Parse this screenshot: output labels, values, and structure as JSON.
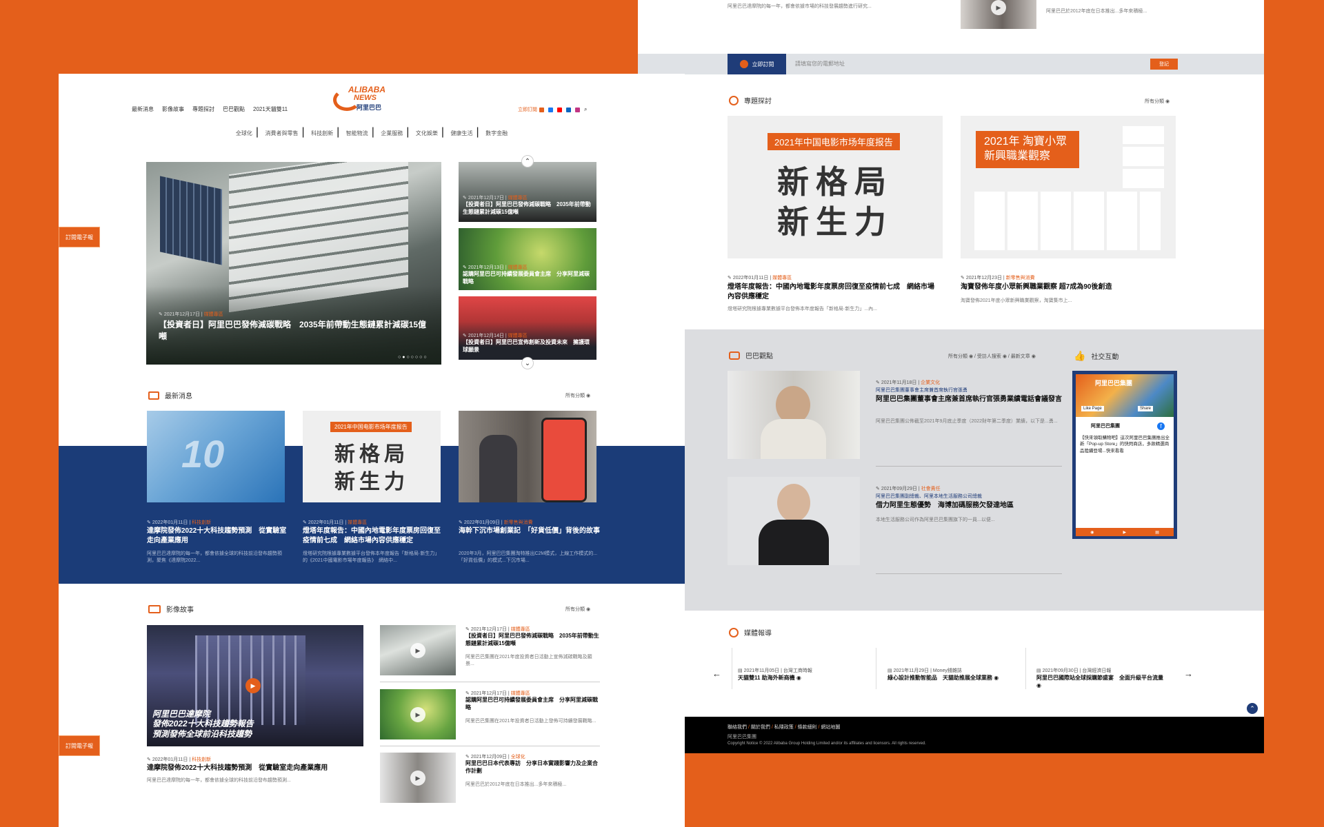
{
  "right_page": {
    "top_snippets": {
      "left_excerpt": "阿里巴巴達摩院的每一年，都會依據市場的科技發展趨勢進行研究...",
      "right_excerpt": "阿里巴巴於2012年底在日本推出...多年來積極..."
    },
    "subscribe": {
      "button_label": "立即訂閱",
      "placeholder": "請填寫您的電郵地址",
      "submit_label": "登記"
    },
    "topics": {
      "title": "專題探討",
      "more": "所有分類",
      "cards": [
        {
          "image_caption": "2021年中国电影市场年度报告",
          "image_big": "新格局",
          "image_big2": "新生力",
          "date": "2022年01月11日",
          "category": "媒體專區",
          "title": "燈塔年度報告：中國內地電影年度票房回復至疫情前七成　網絡市場內容供應穩定",
          "excerpt": "燈塔研究院根據專業數據平台發佈本年度報告「新格局·新生力」...內..."
        },
        {
          "image_caption": "2021年 淘寶小眾新興職業觀察",
          "date": "2021年12月23日",
          "category": "新零售與消費",
          "title": "淘寶發佈年度小眾新興職業觀察 超7成為90後創造",
          "excerpt": "淘寶發佈2021年度小眾新興職業觀察，淘寶集市上... "
        }
      ]
    },
    "baba": {
      "title": "巴巴觀點",
      "links": [
        "所有分類",
        "受訪人搜索",
        "最新文章"
      ],
      "items": [
        {
          "date": "2021年11月18日",
          "category": "企業文化",
          "author": "阿里巴巴集團董事會主席兼首席執行官張勇",
          "title": "阿里巴巴集團董事會主席兼首席執行官張勇業績電話會議發言",
          "excerpt": "阿里巴巴集團公佈截至2021年9月底止季度（2022財年第二季度）業績，以下是...勇..."
        },
        {
          "date": "2021年09月29日",
          "category": "社會責任",
          "author": "阿里巴巴集團副總裁、阿里本地生活服務公司總裁",
          "title": "借力阿里生態優勢　海博加碼服務欠發達地區",
          "excerpt": "本地生活服務公司作為阿里巴巴集團旗下的一員...以便..."
        }
      ]
    },
    "social": {
      "title": "社交互動",
      "fb_name": "阿里巴巴集團",
      "fb_like": "Like Page",
      "fb_share": "Share",
      "post_text": "【快來領取購物吧】這次阿里巴巴集團推出全新「Pop-up Store」的快閃商店，多款精選商品陸續登場...快來看看"
    },
    "media": {
      "title": "媒體報導",
      "items": [
        {
          "meta": "2021年11月05日 | 台灣工商時報",
          "title": "天貓雙11 助海外新商機"
        },
        {
          "meta": "2021年11月29日 | Money錢雜誌",
          "title": "綠心設計推動智能品　天貓助推展全球業務"
        },
        {
          "meta": "2021年09月30日 | 台灣經濟日報",
          "title": "阿里巴巴國際站全球採購節盛宴　全面升級平台流量"
        }
      ]
    },
    "footer": {
      "links": [
        "聯絡我們",
        "關於我們",
        "私隱政策",
        "條款細則",
        "網站地圖"
      ],
      "tagline": "阿里巴巴集團",
      "copyright": "Copyright Notice © 2022 Alibaba Group Holding Limited and/or its affiliates and licensors. All rights reserved."
    }
  },
  "left_page": {
    "logo": {
      "line1": "ALIBABA",
      "line2": "NEWS",
      "line3": "阿里巴巴"
    },
    "nav": [
      "最新消息",
      "影像故事",
      "專題探討",
      "巴巴觀點",
      "2021天貓雙11"
    ],
    "subscribe_label": "立即訂閱",
    "subnav": [
      "全球化",
      "消費者與零售",
      "科技創新",
      "智能物流",
      "企業服務",
      "文化娛樂",
      "健康生活",
      "數字金融"
    ],
    "side_tag": "訂閱電子報",
    "hero": {
      "date": "2021年12月17日",
      "category": "媒體專區",
      "title": "【投資者日】阿里巴巴發佈減碳戰略　2035年前帶動生態鏈累計減碳15億噸"
    },
    "side_stories": [
      {
        "date": "2021年12月17日",
        "category": "媒體專區",
        "title": "【投資者日】阿里巴巴發佈減碳戰略　2035年前帶動生態鏈累計減碳15億噸"
      },
      {
        "date": "2021年12月13日",
        "category": "媒體專區",
        "title": "認購阿里巴巴可持續發展委員會主席　分享阿里減碳戰略"
      },
      {
        "date": "2021年12月14日",
        "category": "媒體專區",
        "title": "【投資者日】阿里巴巴宣佈創新及投資未來　擁護環球願景"
      }
    ],
    "latest": {
      "title": "最新消息",
      "more": "所有分類",
      "image_caption": "2021年中国电影市场年度报告",
      "image_big": "新格局",
      "image_big2": "新生力",
      "cards": [
        {
          "date": "2022年01月11日",
          "category": "科技創新",
          "title": "達摩院發佈2022十大科技趨勢預測　從實驗室走向產業應用",
          "excerpt": "阿里巴巴達摩院的每一年，都會依據全球的科技前沿發布趨勢預測，聚焦《達摩院2022..."
        },
        {
          "date": "2022年01月11日",
          "category": "媒體專區",
          "title": "燈塔年度報告：中國內地電影年度票房回復至疫情前七成　網絡市場內容供應穩定",
          "excerpt": "燈塔研究院根據專業數據平台發佈本年度報告「新格局·新生力」的《2021中國電影市場年度報告》　網絡中..."
        },
        {
          "date": "2022年01月09日",
          "category": "新零售與消費",
          "title": "海幹下沉市場創業記　「好貨低價」背後的故事",
          "excerpt": "2020年3月，阿里巴巴集團淘特推出C2M模式，上線工作模式的...「好貨低價」的模式...下沉市場..."
        }
      ]
    },
    "video": {
      "title": "影像故事",
      "more": "所有分類",
      "main_overlay1": "阿里巴巴達摩院",
      "main_overlay2": "發佈2022十大科技趨勢報告",
      "main_overlay3": "預測發佈全球前沿科技趨勢",
      "main_date": "2022年01月11日",
      "main_category": "科技創新",
      "main_title": "達摩院發佈2022十大科技趨勢預測　從實驗室走向產業應用",
      "main_excerpt": "阿里巴巴達摩院的每一年，都會依據全球的科技前沿發布趨勢預測...",
      "items": [
        {
          "date": "2021年12月17日",
          "category": "媒體專區",
          "title": "【投資者日】阿里巴巴發佈減碳戰略　2035年前帶動生態鏈累計減碳15億噸",
          "excerpt": "阿里巴巴集團在2021年度投資者日活動上宣佈減碳戰略及願景..."
        },
        {
          "date": "2021年12月17日",
          "category": "媒體專區",
          "title": "認購阿里巴巴可持續發展委員會主席　分享阿里減碳戰略",
          "excerpt": "阿里巴巴集團在2021年投資者日活動上發佈可持續發展戰略..."
        },
        {
          "date": "2021年12月09日",
          "category": "全球化",
          "title": "阿里巴巴日本代表專訪　分享日本實踐影響力及企業合作計劃",
          "excerpt": "阿里巴巴於2012年底在日本推出...多年來積極..."
        }
      ]
    }
  }
}
